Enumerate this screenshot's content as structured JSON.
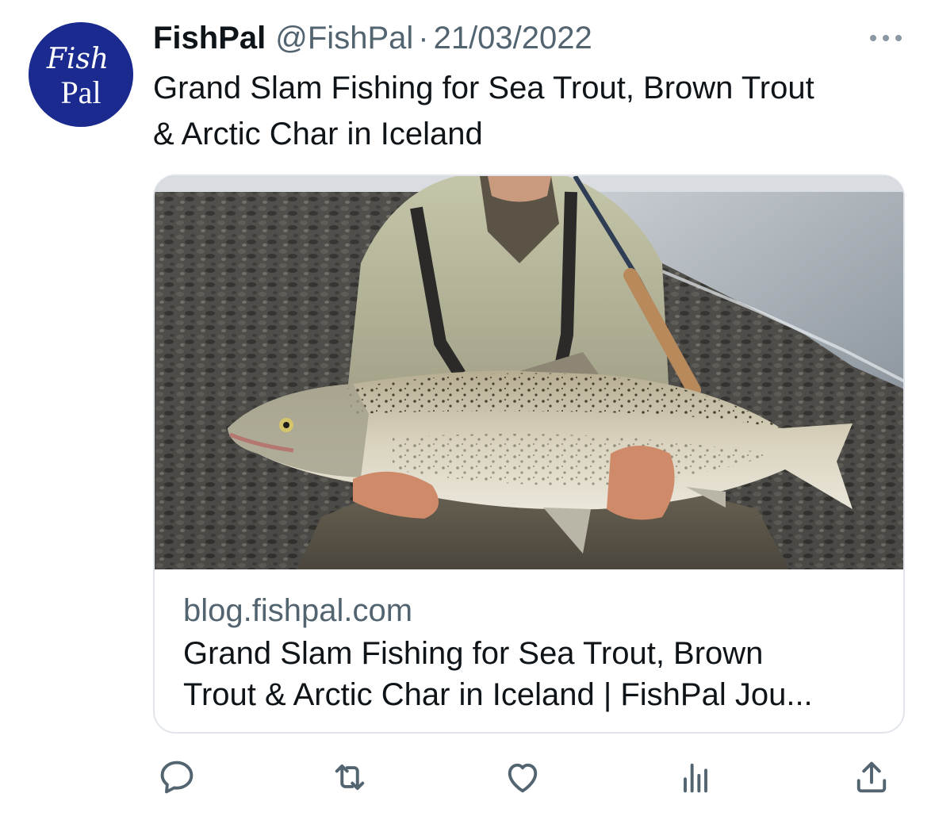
{
  "tweet": {
    "display_name": "FishPal",
    "handle": "@FishPal",
    "separator": "·",
    "date": "21/03/2022",
    "text_line1": "Grand Slam Fishing for Sea Trout, Brown Trout",
    "text_line2": "& Arctic Char in Iceland"
  },
  "avatar": {
    "line1": "Fish",
    "line2": "Pal",
    "background": "#1a2a8f"
  },
  "card": {
    "domain": "blog.fishpal.com",
    "title_line1": "Grand Slam Fishing for Sea Trout, Brown",
    "title_line2": "Trout & Arctic Char in Iceland | FishPal Jou..."
  },
  "actions": {
    "reply_icon": "reply-icon",
    "retweet_icon": "retweet-icon",
    "like_icon": "heart-icon",
    "views_icon": "views-icon",
    "share_icon": "share-icon"
  },
  "colors": {
    "text": "#0f1419",
    "secondary": "#536471",
    "border": "#e2e6ea"
  }
}
